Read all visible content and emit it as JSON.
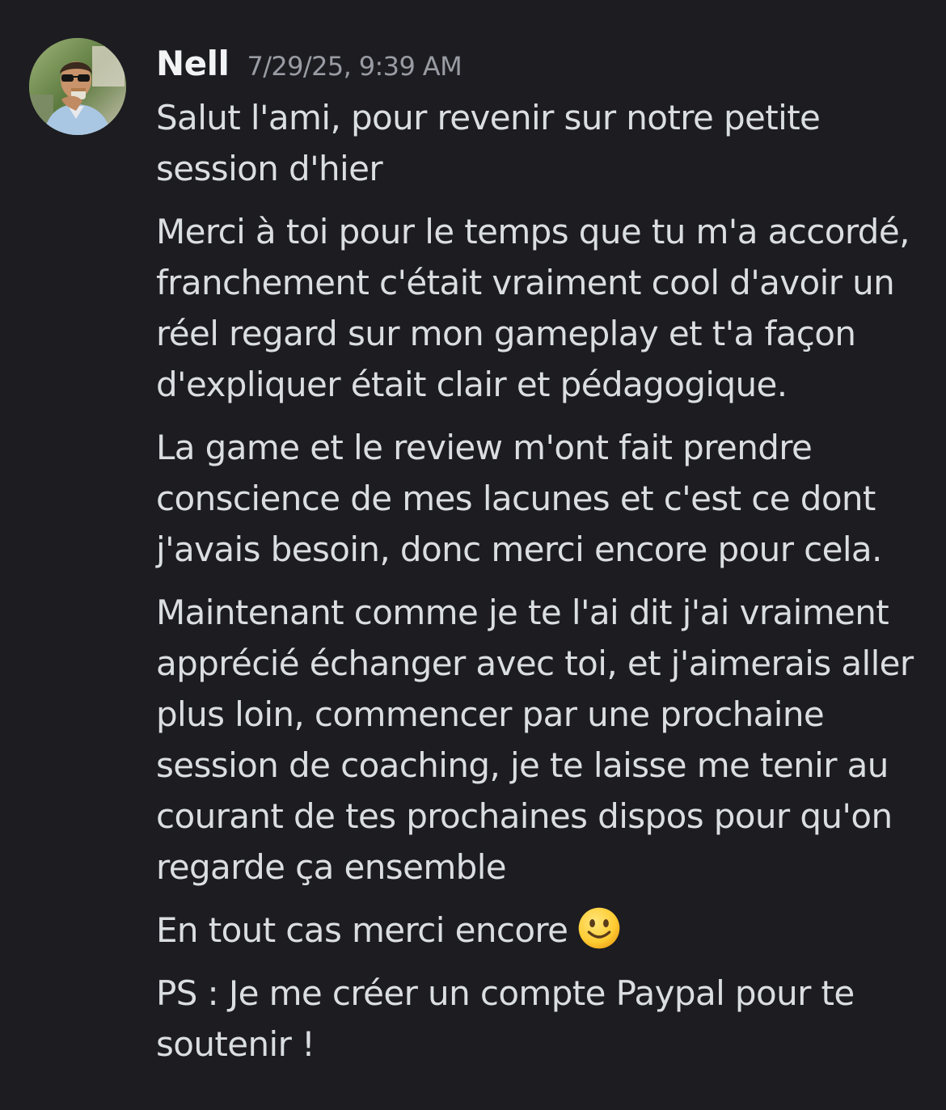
{
  "message": {
    "author": "Nell",
    "timestamp": "7/29/25, 9:39 AM",
    "avatar_icon": "user-avatar-photo",
    "paragraphs": [
      {
        "lines": [
          "Salut l'ami, pour revenir sur notre petite",
          "session d'hier"
        ]
      },
      {
        "lines": [
          "Merci à toi pour le temps que tu m'a accordé,",
          "franchement c'était vraiment cool d'avoir un",
          "réel regard sur mon gameplay et t'a façon",
          "d'expliquer était clair et pédagogique."
        ]
      },
      {
        "lines": [
          "La game et le review m'ont fait prendre",
          "conscience de mes lacunes et c'est ce dont",
          "j'avais besoin, donc merci encore pour cela."
        ]
      },
      {
        "lines": [
          "Maintenant comme je te l'ai dit j'ai vraiment",
          "apprécié échanger avec toi, et j'aimerais aller",
          "plus loin, commencer par une prochaine",
          "session de coaching, je te laisse me tenir au",
          "courant de tes prochaines dispos pour qu'on",
          "regarde ça ensemble"
        ]
      },
      {
        "lines": [
          "En tout cas merci encore"
        ],
        "emoji": "slightly-smiling-face-icon"
      },
      {
        "lines": [
          "PS : Je me créer un compte Paypal pour te",
          "soutenir !"
        ]
      }
    ]
  },
  "colors": {
    "background": "#1c1c21",
    "username": "#f2f3f5",
    "timestamp": "#9a9ca4",
    "message_text": "#dbdee1"
  }
}
